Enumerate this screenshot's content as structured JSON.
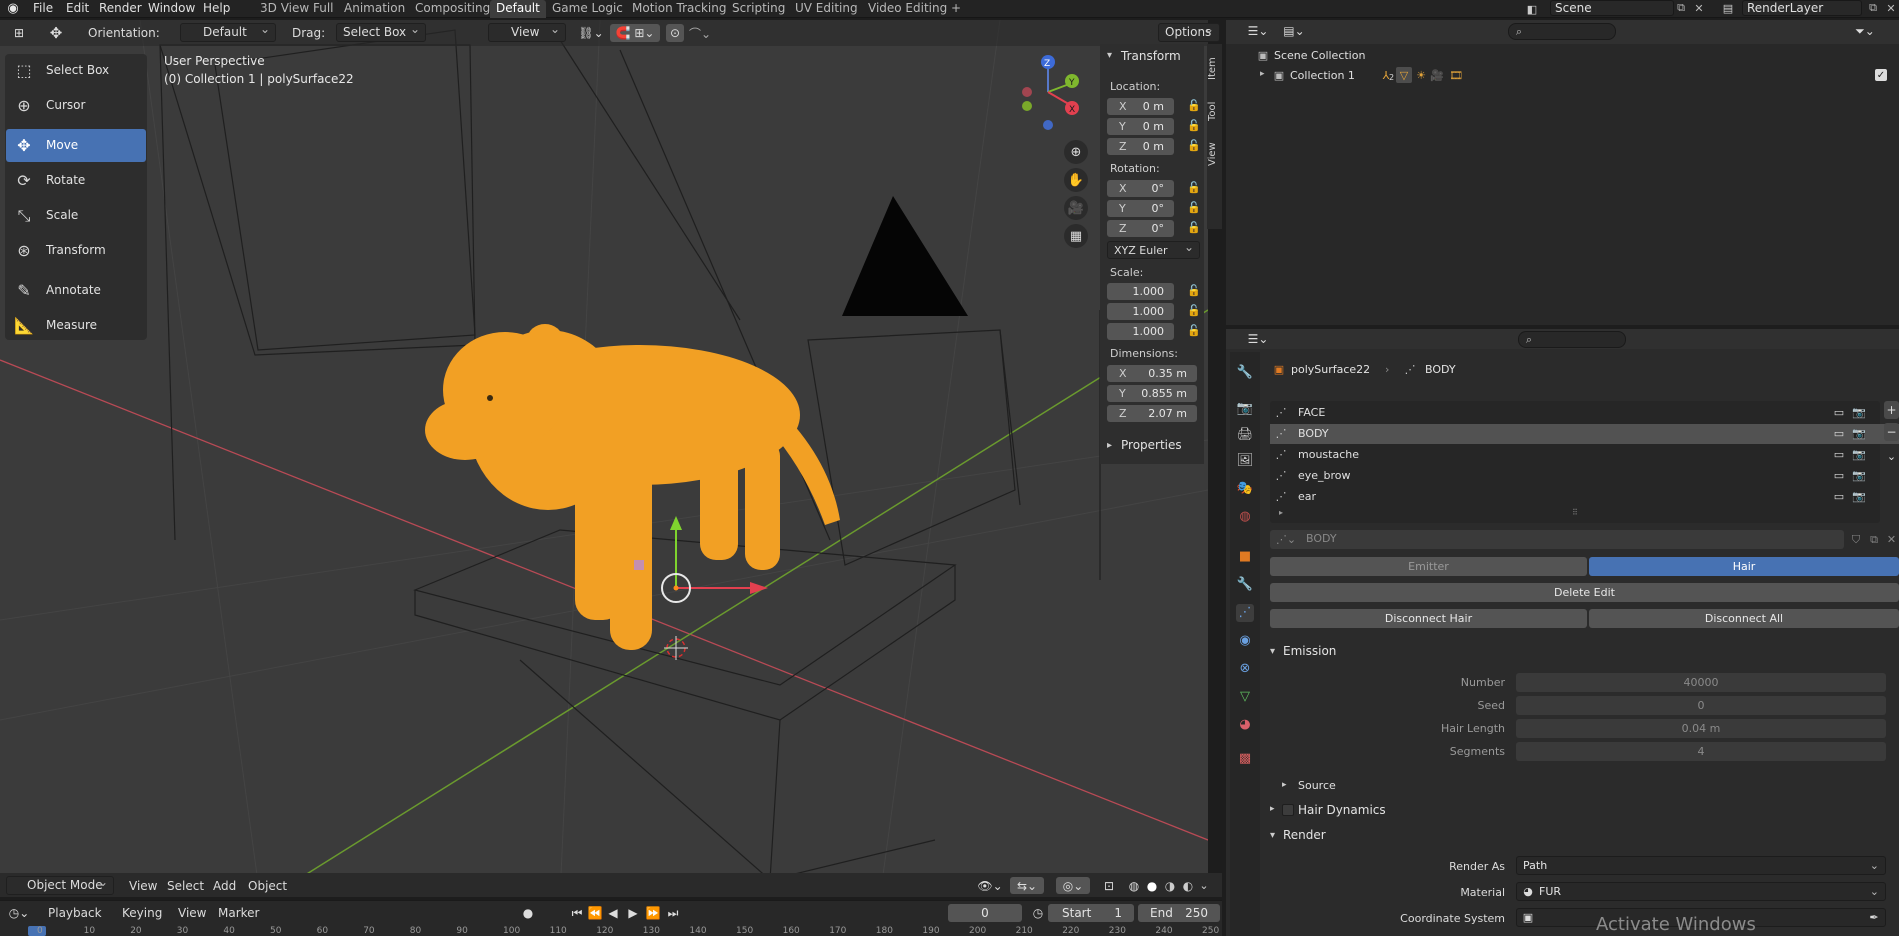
{
  "menubar": {
    "file": "File",
    "edit": "Edit",
    "render": "Render",
    "window": "Window",
    "help": "Help",
    "workspaces": [
      "3D View Full",
      "Animation",
      "Compositing",
      "Default",
      "Game Logic",
      "Motion Tracking",
      "Scripting",
      "UV Editing",
      "Video Editing"
    ],
    "active_workspace": "Default",
    "add_tab": "+",
    "scene": "Scene",
    "render_layer": "RenderLayer"
  },
  "viewport_header": {
    "orientation_label": "Orientation:",
    "orientation_value": "Default",
    "drag_label": "Drag:",
    "drag_value": "Select Box",
    "view": "View",
    "options": "Options"
  },
  "viewport": {
    "perspective": "User Perspective",
    "collection_info": "(0) Collection 1 | polySurface22",
    "gizmo_axes": {
      "z": "Z",
      "y": "Y",
      "x": "X"
    }
  },
  "tools": [
    "Select Box",
    "Cursor",
    "Move",
    "Rotate",
    "Scale",
    "Transform",
    "Annotate",
    "Measure"
  ],
  "active_tool": "Move",
  "npanel": {
    "title": "Transform",
    "location_label": "Location:",
    "location": [
      {
        "axis": "X",
        "value": "0 m"
      },
      {
        "axis": "Y",
        "value": "0 m"
      },
      {
        "axis": "Z",
        "value": "0 m"
      }
    ],
    "rotation_label": "Rotation:",
    "rotation": [
      {
        "axis": "X",
        "value": "0°"
      },
      {
        "axis": "Y",
        "value": "0°"
      },
      {
        "axis": "Z",
        "value": "0°"
      }
    ],
    "rotation_mode": "XYZ Euler",
    "scale_label": "Scale:",
    "scale": [
      "1.000",
      "1.000",
      "1.000"
    ],
    "dimensions_label": "Dimensions:",
    "dimensions": [
      {
        "axis": "X",
        "value": "0.35 m"
      },
      {
        "axis": "Y",
        "value": "0.855 m"
      },
      {
        "axis": "Z",
        "value": "2.07 m"
      }
    ],
    "properties": "Properties",
    "tabs": [
      "Item",
      "Tool",
      "View"
    ]
  },
  "viewport_footer": {
    "mode": "Object Mode",
    "view": "View",
    "select": "Select",
    "add": "Add",
    "object": "Object"
  },
  "timeline": {
    "playback": "Playback",
    "keying": "Keying",
    "view": "View",
    "marker": "Marker",
    "current_frame": "0",
    "start_label": "Start",
    "start": "1",
    "end_label": "End",
    "end": "250",
    "ruler": [
      "0",
      "10",
      "20",
      "30",
      "40",
      "50",
      "60",
      "70",
      "80",
      "90",
      "100",
      "110",
      "120",
      "130",
      "140",
      "150",
      "160",
      "170",
      "180",
      "190",
      "200",
      "210",
      "220",
      "230",
      "240",
      "250"
    ]
  },
  "outliner": {
    "scene_collection": "Scene Collection",
    "collection": "Collection 1",
    "badge_count": "2"
  },
  "properties": {
    "object": "polySurface22",
    "particle_system": "BODY",
    "systems": [
      "FACE",
      "BODY",
      "moustache",
      "eye_brow",
      "ear"
    ],
    "active_system": "BODY",
    "settings_name": "BODY",
    "type_emitter": "Emitter",
    "type_hair": "Hair",
    "delete_edit": "Delete Edit",
    "disconnect_hair": "Disconnect Hair",
    "disconnect_all": "Disconnect All",
    "emission": {
      "title": "Emission",
      "fields": [
        {
          "label": "Number",
          "value": "40000"
        },
        {
          "label": "Seed",
          "value": "0"
        },
        {
          "label": "Hair Length",
          "value": "0.04 m"
        },
        {
          "label": "Segments",
          "value": "4"
        }
      ]
    },
    "source": "Source",
    "hair_dynamics": "Hair Dynamics",
    "render": {
      "title": "Render",
      "render_as_label": "Render As",
      "render_as": "Path",
      "material_label": "Material",
      "material": "FUR",
      "coord_label": "Coordinate System"
    }
  },
  "watermark": "Activate Windows",
  "colors": {
    "accent": "#4772b3",
    "fur": "#f2a024",
    "viewport_bg": "#3b3b3b"
  }
}
